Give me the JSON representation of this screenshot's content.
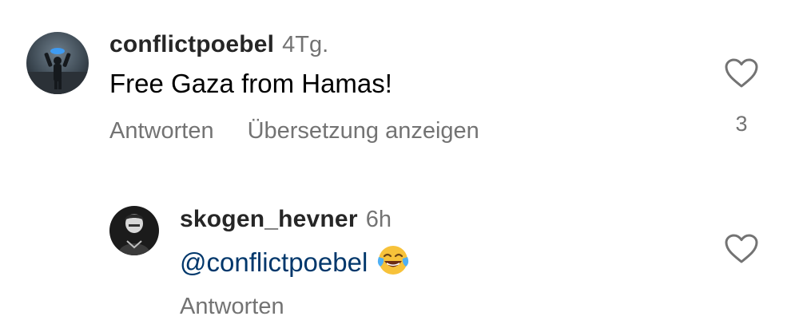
{
  "comments": [
    {
      "username": "conflictpoebel",
      "time": "4Tg.",
      "text": "Free Gaza from Hamas!",
      "actions": {
        "reply": "Antworten",
        "translate": "Übersetzung anzeigen"
      },
      "like_count": "3",
      "avatar_icon": "profile-photo"
    },
    {
      "username": "skogen_hevner",
      "time": "6h",
      "mention": "@conflictpoebel",
      "emoji": "😂",
      "actions": {
        "reply": "Antworten"
      },
      "avatar_icon": "profile-photo"
    }
  ],
  "colors": {
    "username": "#262626",
    "secondary": "#737373",
    "mention": "#00376b"
  },
  "icons": {
    "like": "heart-outline-icon"
  }
}
